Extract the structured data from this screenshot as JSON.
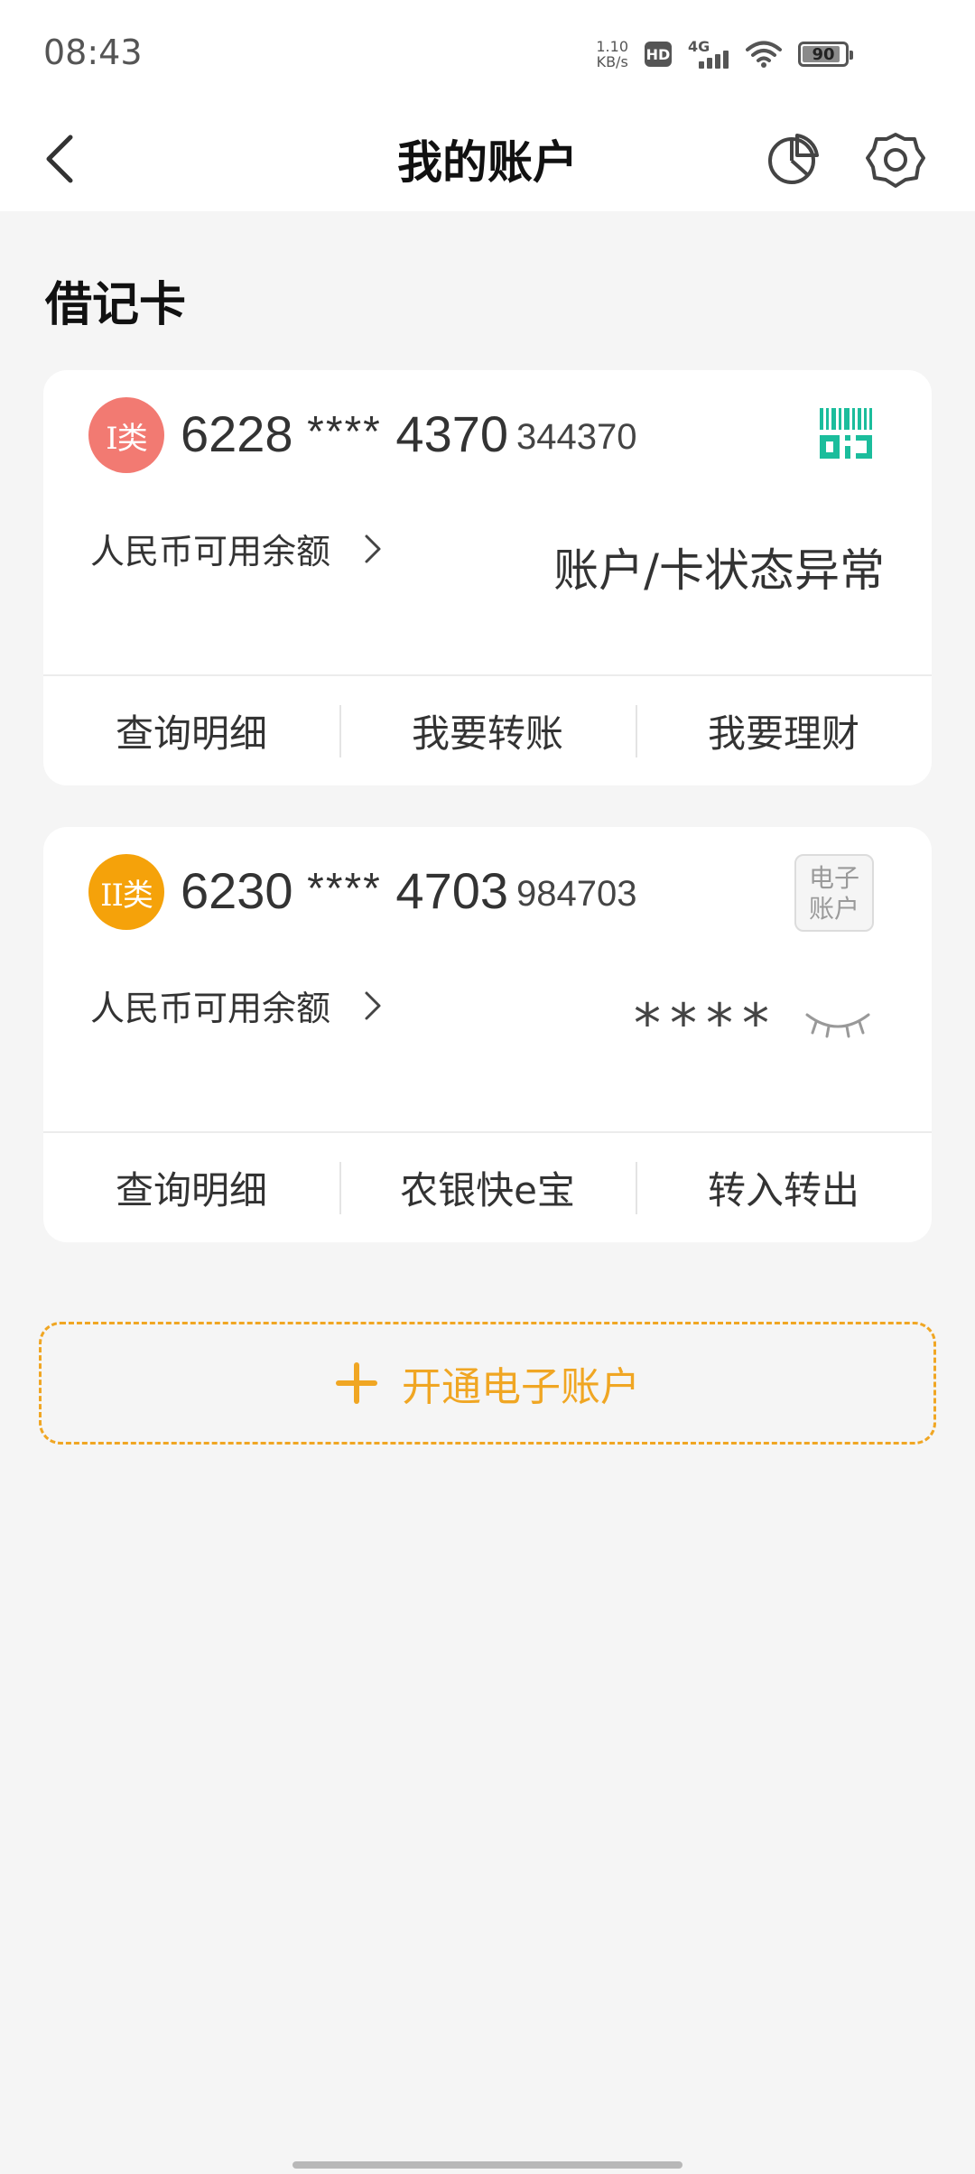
{
  "status_bar": {
    "time": "08:43",
    "net_speed_value": "1.10",
    "net_speed_unit": "KB/s",
    "hd_label": "HD",
    "network_type": "4G",
    "battery_level": "90"
  },
  "header": {
    "title": "我的账户",
    "icons": [
      "back-icon",
      "pie-chart-icon",
      "gear-icon"
    ]
  },
  "section": {
    "title": "借记卡"
  },
  "cards": [
    {
      "type_label": "I类",
      "number_prefix": "6228",
      "number_mask": "****",
      "number_suffix": "4370",
      "short_number": "344370",
      "balance_label": "人民币可用余额",
      "status_text": "账户/卡状态异常",
      "accent_color": "#f27a72",
      "icon": "qr-code-icon",
      "actions": [
        "查询明细",
        "我要转账",
        "我要理财"
      ]
    },
    {
      "type_label": "II类",
      "number_prefix": "6230",
      "number_mask": "****",
      "number_suffix": "4703",
      "short_number": "984703",
      "balance_label": "人民币可用余额",
      "hidden_balance": "****",
      "tag_line1": "电子",
      "tag_line2": "账户",
      "accent_color": "#f5a20a",
      "icon": "eye-closed-icon",
      "actions": [
        "查询明细",
        "农银快e宝",
        "转入转出"
      ]
    }
  ],
  "open_account": {
    "label": "开通电子账户",
    "color": "#f0a623"
  }
}
